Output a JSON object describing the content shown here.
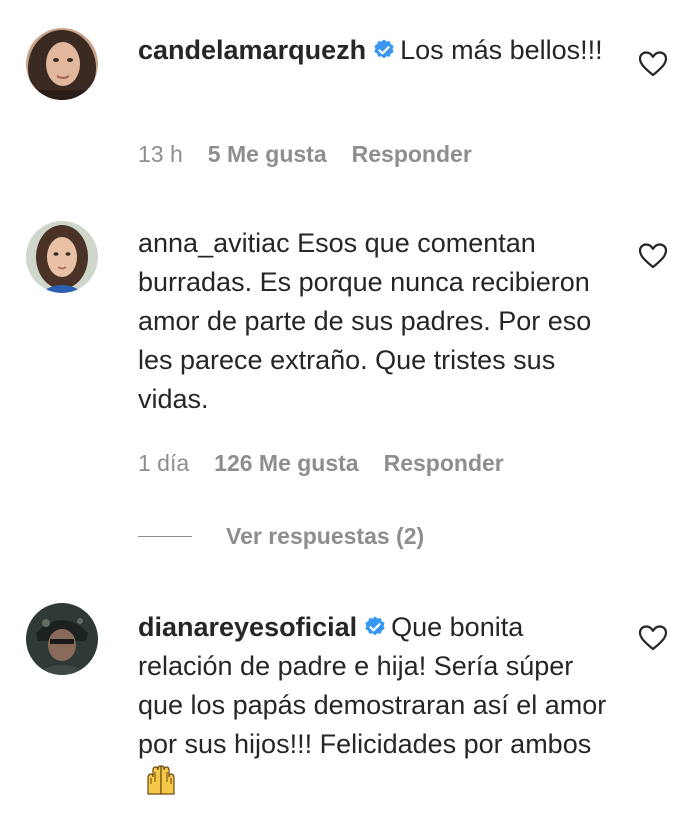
{
  "colors": {
    "text": "#262626",
    "muted": "#8e8e8e",
    "verified": "#3897f0"
  },
  "comments": [
    {
      "username": "candelamarquezh",
      "verified": true,
      "text": "Los más bellos!!!",
      "time": "13 h",
      "likes": "5 Me gusta",
      "reply": "Responder",
      "avatar_icon": "avatar-photo",
      "like_icon": "heart-outline-icon"
    },
    {
      "username": "anna_avitiac",
      "verified": false,
      "text": "Esos que comentan burradas. Es porque nunca recibieron amor de parte de sus padres. Por eso les parece extraño. Que tristes sus vidas.",
      "time": "1 día",
      "likes": "126 Me gusta",
      "reply": "Responder",
      "view_replies": "Ver respuestas (2)",
      "avatar_icon": "avatar-photo",
      "like_icon": "heart-outline-icon"
    },
    {
      "username": "dianareyesoficial",
      "verified": true,
      "text": "Que bonita relación de padre e hija! Sería súper que los papás demostraran así el amor por sus hijos!!! Felicidades por ambos",
      "emoji": "raising-hands-emoji",
      "avatar_icon": "avatar-photo",
      "like_icon": "heart-outline-icon"
    }
  ]
}
